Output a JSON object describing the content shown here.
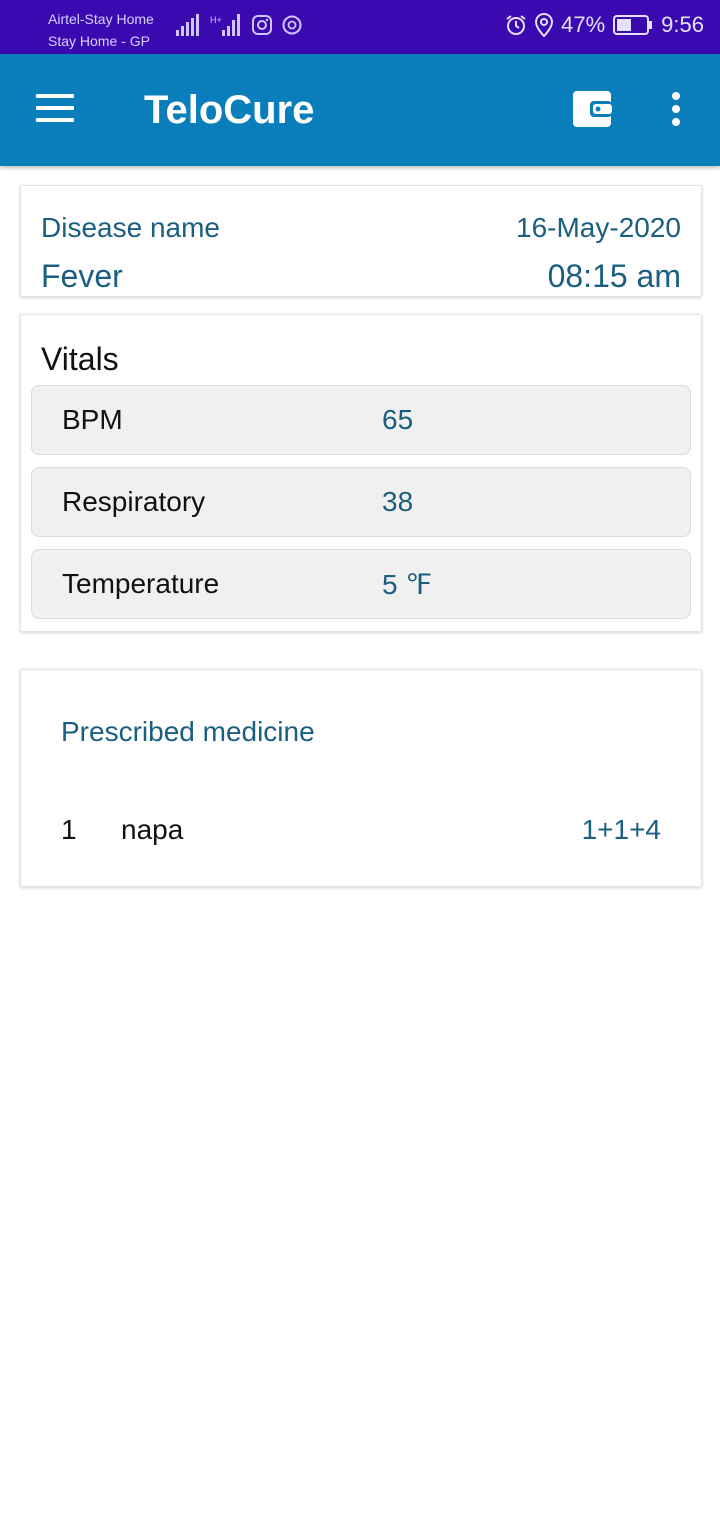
{
  "status_bar": {
    "carrier_line1": "Airtel-Stay Home",
    "carrier_line2": "Stay Home - GP",
    "battery_percent": "47%",
    "time": "9:56"
  },
  "app_bar": {
    "title": "TeloCure"
  },
  "disease": {
    "label": "Disease name",
    "name": "Fever",
    "date": "16-May-2020",
    "time": "08:15 am"
  },
  "vitals": {
    "title": "Vitals",
    "rows": [
      {
        "name": "BPM",
        "value": "65"
      },
      {
        "name": "Respiratory",
        "value": "38"
      },
      {
        "name": "Temperature",
        "value": "5 ℉"
      }
    ]
  },
  "prescription": {
    "title": "Prescribed medicine",
    "medicines": [
      {
        "index": "1",
        "name": "napa",
        "dose": "1+1+4"
      }
    ]
  },
  "colors": {
    "status_bar": "#3a0ab0",
    "app_bar": "#0a7dbb",
    "accent_text": "#1a5f80"
  }
}
